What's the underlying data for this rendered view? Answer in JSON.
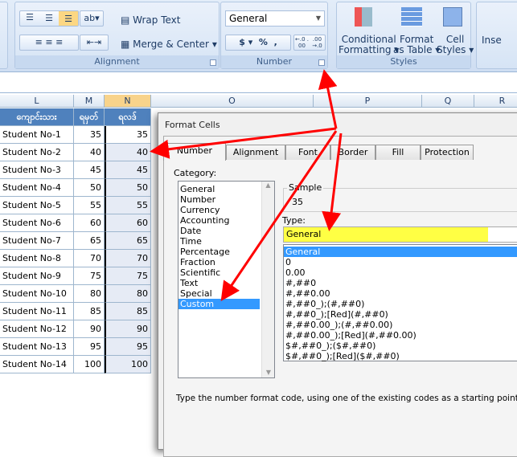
{
  "ribbon": {
    "wrap_text": "Wrap Text",
    "merge_center": "Merge & Center",
    "alignment_label": "Alignment",
    "number_format_value": "General",
    "currency_symbol": "$",
    "percent_symbol": "%",
    "comma_symbol": ",",
    "increase_decimal": "←.0 .00",
    "decrease_decimal": ".00 →.0",
    "number_label": "Number",
    "conditional_formatting": [
      "Conditional",
      "Formatting ▾"
    ],
    "format_as_table": [
      "Format",
      "as Table ▾"
    ],
    "cell_styles": [
      "Cell",
      "Styles ▾"
    ],
    "insert": "Inse",
    "styles_label": "Styles"
  },
  "sheet": {
    "columns": [
      "L",
      "M",
      "N",
      "O",
      "P",
      "Q",
      "R"
    ],
    "headers": [
      "ကျောင်းသား",
      "ရမှတ်",
      "ရလဒ်"
    ],
    "rows": [
      [
        "Student No-1",
        "35",
        "35"
      ],
      [
        "Student No-2",
        "40",
        "40"
      ],
      [
        "Student No-3",
        "45",
        "45"
      ],
      [
        "Student No-4",
        "50",
        "50"
      ],
      [
        "Student No-5",
        "55",
        "55"
      ],
      [
        "Student No-6",
        "60",
        "60"
      ],
      [
        "Student No-7",
        "65",
        "65"
      ],
      [
        "Student No-8",
        "70",
        "70"
      ],
      [
        "Student No-9",
        "75",
        "75"
      ],
      [
        "Student No-10",
        "80",
        "80"
      ],
      [
        "Student No-11",
        "85",
        "85"
      ],
      [
        "Student No-12",
        "90",
        "90"
      ],
      [
        "Student No-13",
        "95",
        "95"
      ],
      [
        "Student No-14",
        "100",
        "100"
      ]
    ]
  },
  "dialog": {
    "title": "Format Cells",
    "tabs": [
      "Number",
      "Alignment",
      "Font",
      "Border",
      "Fill",
      "Protection"
    ],
    "active_tab": "Number",
    "category_label": "Category:",
    "categories": [
      "General",
      "Number",
      "Currency",
      "Accounting",
      "Date",
      "Time",
      "Percentage",
      "Fraction",
      "Scientific",
      "Text",
      "Special",
      "Custom"
    ],
    "selected_category": "Custom",
    "sample_label": "Sample",
    "sample_value": "35",
    "type_label": "Type:",
    "type_value": "General",
    "type_list": [
      "General",
      "0",
      "0.00",
      "#,##0",
      "#,##0.00",
      "#,##0_);(#,##0)",
      "#,##0_);[Red](#,##0)",
      "#,##0.00_);(#,##0.00)",
      "#,##0.00_);[Red](#,##0.00)",
      "$#,##0_);($#,##0)",
      "$#,##0_);[Red]($#,##0)"
    ],
    "help_text": "Type the number format code, using one of the existing codes as a starting point."
  },
  "colors": {
    "header_fill": "#4f81bd",
    "type_highlight": "#ffff44",
    "selection": "#3399ff",
    "arrow": "#ff0000"
  }
}
